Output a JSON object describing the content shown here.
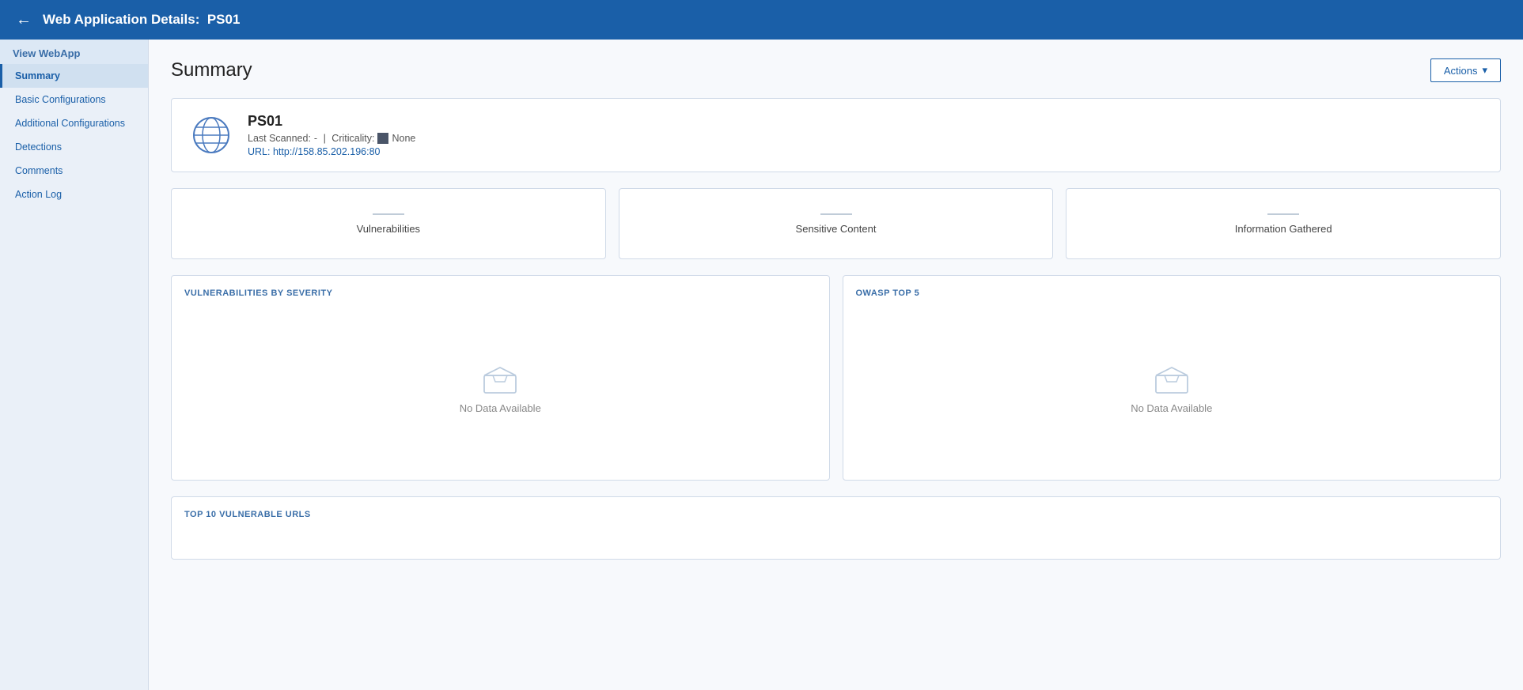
{
  "header": {
    "back_icon": "←",
    "title_prefix": "Web Application Details:",
    "title_name": "PS01"
  },
  "sidebar": {
    "section_label": "View WebApp",
    "items": [
      {
        "label": "Summary",
        "active": true
      },
      {
        "label": "Basic Configurations",
        "active": false
      },
      {
        "label": "Additional Configurations",
        "active": false
      },
      {
        "label": "Detections",
        "active": false
      },
      {
        "label": "Comments",
        "active": false
      },
      {
        "label": "Action Log",
        "active": false
      }
    ]
  },
  "main": {
    "page_title": "Summary",
    "actions_button": "Actions",
    "actions_chevron": "▾",
    "app": {
      "name": "PS01",
      "last_scanned_label": "Last Scanned:",
      "last_scanned_value": "-",
      "criticality_label": "Criticality:",
      "criticality_value": "None",
      "url_label": "URL:",
      "url_value": "http://158.85.202.196:80"
    },
    "stat_cards": [
      {
        "label": "Vulnerabilities"
      },
      {
        "label": "Sensitive Content"
      },
      {
        "label": "Information Gathered"
      }
    ],
    "charts": [
      {
        "title": "VULNERABILITIES BY SEVERITY",
        "no_data": "No Data Available"
      },
      {
        "title": "OWASP TOP 5",
        "no_data": "No Data Available"
      }
    ],
    "bottom_card": {
      "title": "TOP 10 VULNERABLE URLS"
    }
  }
}
